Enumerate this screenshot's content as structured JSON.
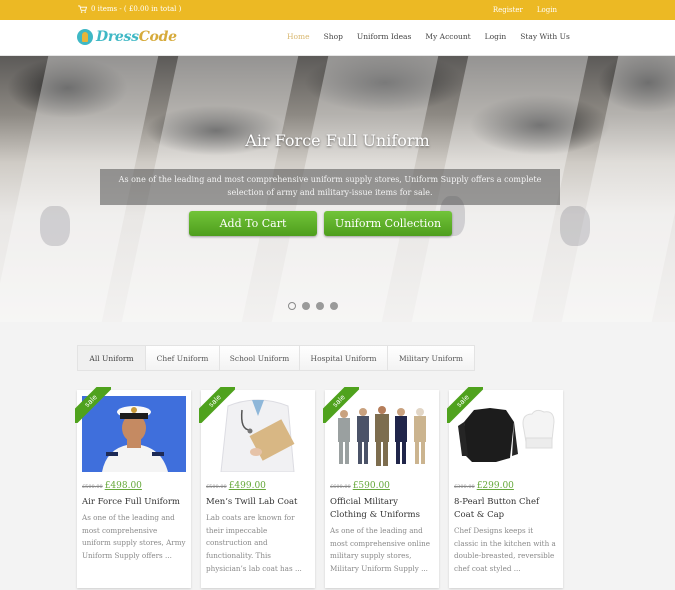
{
  "topbar": {
    "cart_icon": "cart-icon",
    "cart_text": "0 items - ( £0.00 in total )",
    "links": [
      "Register",
      "Login"
    ],
    "color": "#ecb924"
  },
  "header": {
    "logo": {
      "part1": "Dress",
      "part2": "Code",
      "icon": "dress-logo-icon"
    },
    "nav": [
      {
        "label": "Home",
        "active": true
      },
      {
        "label": "Shop"
      },
      {
        "label": "Uniform Ideas"
      },
      {
        "label": "My Account"
      },
      {
        "label": "Login"
      },
      {
        "label": "Stay With Us"
      }
    ]
  },
  "hero": {
    "title": "Air Force Full Uniform",
    "description": "As one of the leading and most comprehensive uniform supply stores, Uniform Supply offers a complete selection of army and military-issue items for sale.",
    "buttons": [
      "Add To Cart",
      "Uniform Collection"
    ],
    "slides": 4,
    "active_slide": 1,
    "button_color": "#5bb02a"
  },
  "tabs": [
    {
      "label": "All Uniform",
      "active": true
    },
    {
      "label": "Chef Uniform"
    },
    {
      "label": "School Uniform"
    },
    {
      "label": "Hospital Uniform"
    },
    {
      "label": "Military Uniform"
    }
  ],
  "products": [
    {
      "badge": "sale",
      "old_price": "£500.00",
      "price": "£498.00",
      "name": "Air Force Full Uniform",
      "description": "As one of the leading and most comprehensive uniform supply stores, Army Uniform Supply offers ..."
    },
    {
      "badge": "sale",
      "old_price": "£500.00",
      "price": "£499.00",
      "name": "Men’s Twill Lab Coat",
      "description": "Lab coats are known for their impeccable construction and functionality. This physician’s lab coat has ..."
    },
    {
      "badge": "sale",
      "old_price": "£600.00",
      "price": "£590.00",
      "name": "Official Military Clothing & Uniforms",
      "description": "As one of the leading and most comprehensive online military supply stores, Military Uniform Supply ..."
    },
    {
      "badge": "sale",
      "old_price": "£300.00",
      "price": "£299.00",
      "name": "8-Pearl Button Chef Coat & Cap",
      "description": "Chef Designs keeps it classic in the kitchen with a double-breasted, reversible chef coat styled ..."
    }
  ]
}
